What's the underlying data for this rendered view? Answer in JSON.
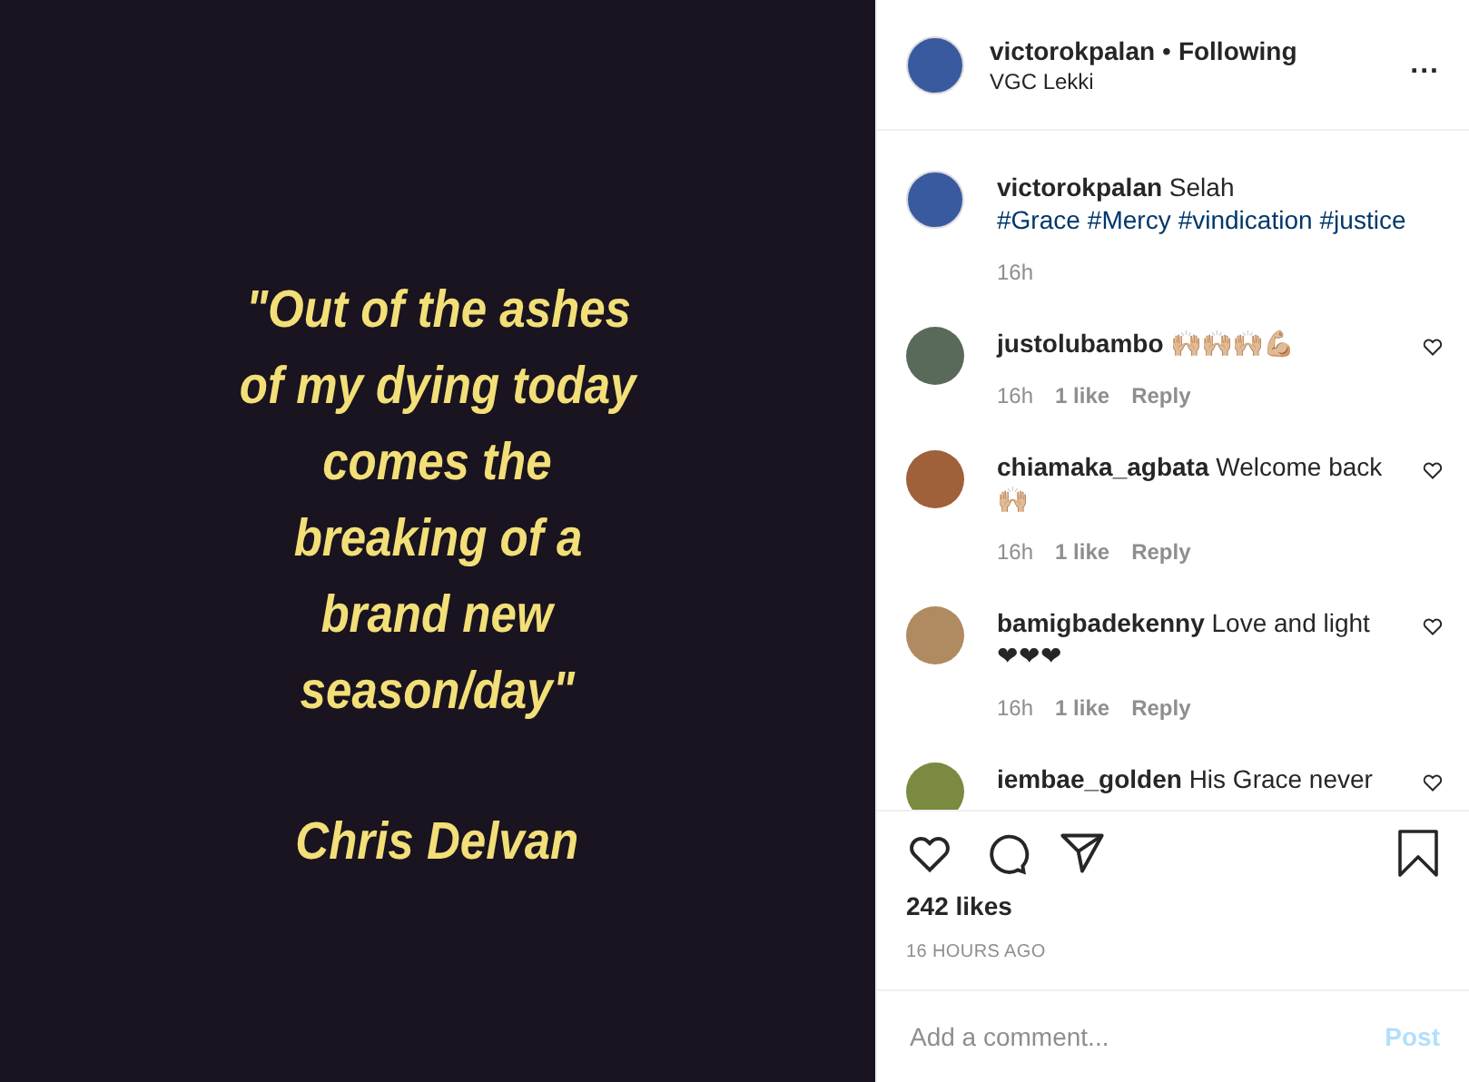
{
  "post_image": {
    "quote_lines": [
      "\"Out of the ashes",
      "of my dying today",
      "comes the",
      "breaking of a",
      "brand new",
      "season/day\""
    ],
    "author": "Chris Delvan"
  },
  "header": {
    "username": "victorokpalan",
    "separator": "•",
    "follow_state": "Following",
    "location": "VGC Lekki",
    "more": "..."
  },
  "caption": {
    "username": "victorokpalan",
    "text": "Selah",
    "hashtags": [
      "#Grace",
      "#Mercy",
      "#vindication",
      "#justice"
    ],
    "time": "16h"
  },
  "comments": [
    {
      "username": "justolubambo",
      "text": "🙌🏼🙌🏼🙌🏼💪🏼",
      "time": "16h",
      "likes": "1 like",
      "reply": "Reply",
      "color": "#5a6a5a"
    },
    {
      "username": "chiamaka_agbata",
      "text": "Welcome back 🙌🏼",
      "time": "16h",
      "likes": "1 like",
      "reply": "Reply",
      "color": "#a0603a"
    },
    {
      "username": "bamigbadekenny",
      "text": "Love and light ❤❤❤",
      "time": "16h",
      "likes": "1 like",
      "reply": "Reply",
      "color": "#b08a60"
    },
    {
      "username": "iembae_golden",
      "text": "His Grace never",
      "color": "#7a8a40"
    }
  ],
  "likes": "242 likes",
  "timestamp": "16 HOURS AGO",
  "comment_input": {
    "placeholder": "Add a comment...",
    "post_button": "Post"
  }
}
